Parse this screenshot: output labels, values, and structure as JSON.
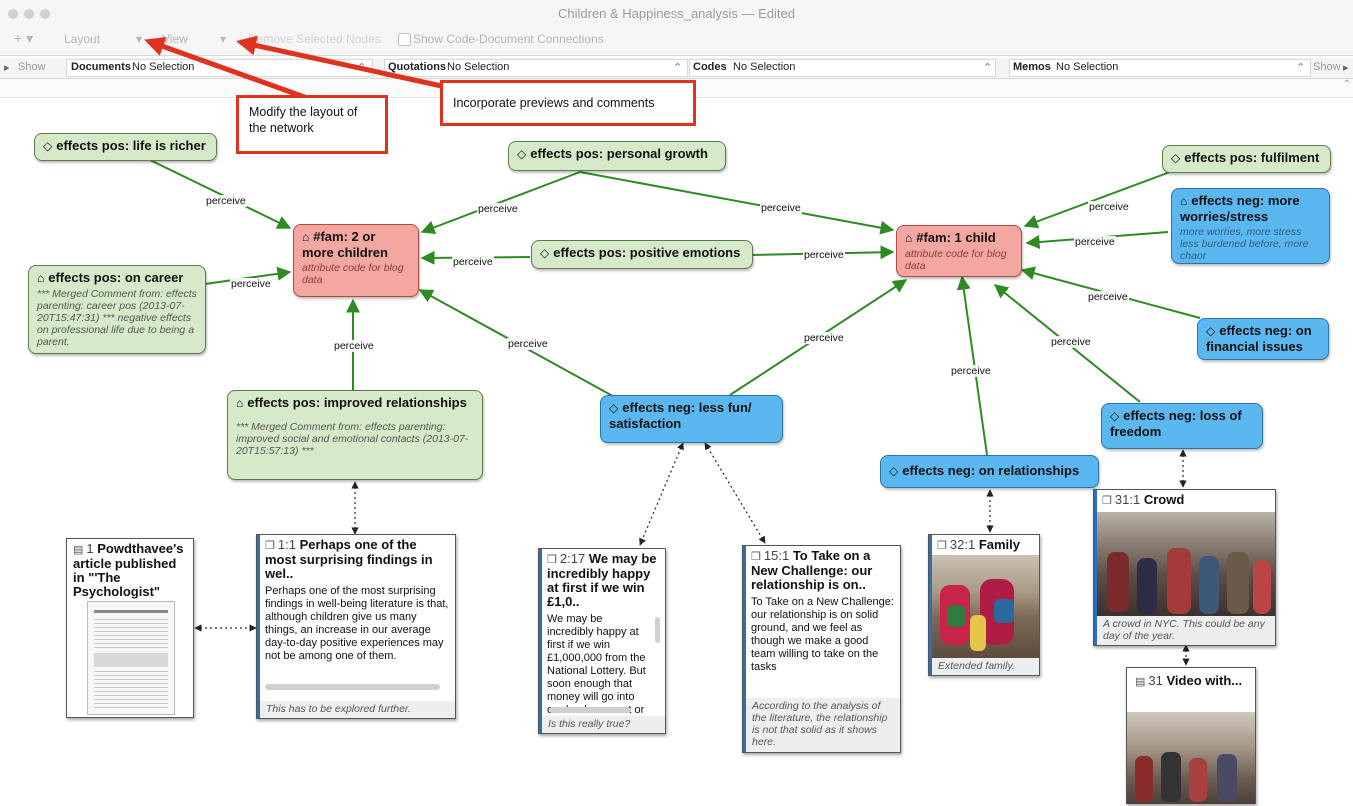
{
  "window": {
    "title": "Children & Happiness_analysis — Edited"
  },
  "toolbar": {
    "add": "+ ▾",
    "layout": "Layout",
    "layout_arrow": "▾",
    "view": "View",
    "view_arrow": "▾",
    "remove": "Remove Selected Nodes",
    "show_connections": "Show Code-Document Connections"
  },
  "filter_bar": {
    "show_left": "Show",
    "documents_label": "Documents",
    "documents_value": "No Selection",
    "quotations_label": "Quotations",
    "quotations_value": "No Selection",
    "codes_label": "Codes",
    "codes_value": "No Selection",
    "memos_label": "Memos",
    "memos_value": "No Selection",
    "show_right": "Show",
    "stepper": "⌃"
  },
  "callouts": {
    "layout": "Modify the layout of the network",
    "previews": "Incorporate previews and comments"
  },
  "edge_label": "perceive",
  "nodes": {
    "life_richer": {
      "icon": "◇",
      "label": "effects pos: life is richer"
    },
    "personal_growth": {
      "icon": "◇",
      "label": "effects pos: personal growth"
    },
    "fulfilment": {
      "icon": "◇",
      "label": "effects pos: fulfilment"
    },
    "fam2": {
      "icon": "⌂",
      "label": "#fam: 2 or more children",
      "comment": "attribute code for blog data"
    },
    "positive_emotions": {
      "icon": "◇",
      "label": "effects pos: positive emotions"
    },
    "fam1": {
      "icon": "⌂",
      "label": "#fam: 1 child",
      "comment": "attribute code for blog data"
    },
    "worries": {
      "icon": "⌂",
      "label": "effects neg: more worries/stress",
      "comment": "more worries, more stress less burdened before, more chaor"
    },
    "career": {
      "icon": "⌂",
      "label": "effects pos: on career",
      "comment": "*** Merged Comment from: effects parenting: career pos (2013-07-20T15:47:31) *** negative effects on professional life due to being a parent."
    },
    "financial": {
      "icon": "◇",
      "label": "effects neg: on financial issues"
    },
    "improved_relationships": {
      "icon": "⌂",
      "label": "effects pos: improved relationships",
      "comment": "*** Merged Comment from: effects parenting: improved social and emotional contacts (2013-07-20T15:57:13) ***"
    },
    "less_fun": {
      "icon": "◇",
      "label": "effects neg: less fun/ satisfaction"
    },
    "loss_freedom": {
      "icon": "◇",
      "label": "effects neg: loss of freedom"
    },
    "on_relationships": {
      "icon": "◇",
      "label": "effects neg: on relationships"
    }
  },
  "docs": {
    "article": {
      "num": "1",
      "title": "Powdthavee's article published in \"'The Psychologist\""
    },
    "q1_1": {
      "num": "1:1",
      "title": "Perhaps one of the most surprising findings in wel..",
      "text": "Perhaps one of the most surprising findings in well-being literature is that, although children give us many things, an increase in our average day-to-day positive experiences may not be among one of them.",
      "comment": "This has to be explored further."
    },
    "q2_17": {
      "num": "2:17",
      "title": "We may be incredibly happy at first if we win £1,0..",
      "text": "We may be incredibly happy at first if we win £1,000,000 from the National Lottery. But soon enough that money will go into our bank account or into",
      "comment": "Is this really true?"
    },
    "q15_1": {
      "num": "15:1",
      "title": "To Take on a New Challenge: our relationship is on..",
      "text": "To Take on a New Challenge: our relationship is on solid ground, and we feel as though we make a good team willing to take on the tasks",
      "comment": "According to the analysis of the literature, the relationship is not that solid as it shows here."
    },
    "q32_1": {
      "num": "32:1",
      "title": "Family",
      "comment": "Extended family."
    },
    "q31_1": {
      "num": "31:1",
      "title": "Crowd",
      "comment": "A crowd in NYC. This could be any day of the year."
    },
    "video": {
      "num": "31",
      "title": "Video with..."
    }
  },
  "colors": {
    "code_green": "#d6e9c8",
    "attribute_red": "#f4a6a1",
    "neg_blue": "#5ab7ef",
    "edge_green": "#2e8b22",
    "callout_red": "#e0331f"
  }
}
